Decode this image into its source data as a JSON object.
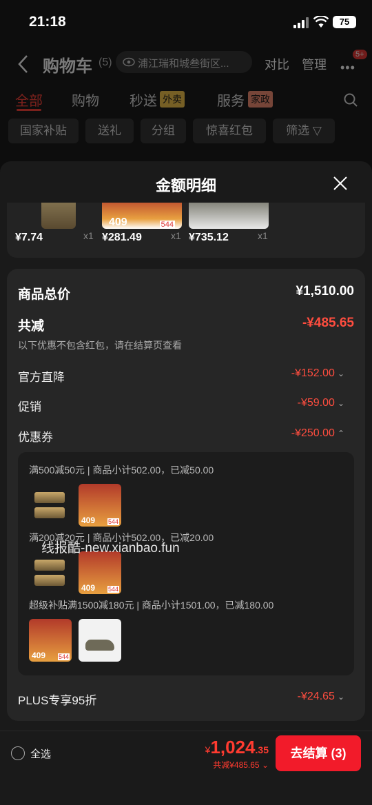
{
  "status": {
    "time": "21:18",
    "battery": "75"
  },
  "header": {
    "title": "购物车",
    "count": "(5)",
    "address": "浦江瑞和城叁街区...",
    "compare": "对比",
    "manage": "管理",
    "badge": "5+"
  },
  "tabs": [
    {
      "label": "全部"
    },
    {
      "label": "购物"
    },
    {
      "label": "秒送",
      "tag": "外卖"
    },
    {
      "label": "服务",
      "tag": "家政"
    }
  ],
  "chips": [
    "国家补贴",
    "送礼",
    "分组",
    "惊喜红包",
    "筛选"
  ],
  "modal": {
    "title": "金额明细",
    "thumbs": [
      {
        "price": "¥7.74",
        "qty": "x1"
      },
      {
        "price": "¥281.49",
        "qty": "x1"
      },
      {
        "price": "¥735.12",
        "qty": "x1"
      }
    ],
    "total_label": "商品总价",
    "total_value": "¥1,510.00",
    "reduce_label": "共减",
    "reduce_value": "-¥485.65",
    "hint": "以下优惠不包含红包，请在结算页查看",
    "rows": [
      {
        "label": "官方直降",
        "value": "-¥152.00"
      },
      {
        "label": "促销",
        "value": "-¥59.00"
      },
      {
        "label": "优惠券",
        "value": "-¥250.00"
      }
    ],
    "coupons": [
      "满500减50元 | 商品小计502.00，已减50.00",
      "满200减20元 | 商品小计502.00，已减20.00",
      "超级补贴满1500减180元 | 商品小计1501.00，已减180.00"
    ],
    "plus_label": "PLUS专享95折",
    "plus_value": "-¥24.65"
  },
  "watermark": "线报酷-new.xianbao.fun",
  "bottom": {
    "select_all": "全选",
    "currency": "¥",
    "price_int": "1,024",
    "price_dec": ".35",
    "reduce": "共减¥485.65",
    "checkout": "去结算 (3)"
  },
  "colors": {
    "accent": "#f21b2a",
    "reduce": "#ff4d3f"
  }
}
